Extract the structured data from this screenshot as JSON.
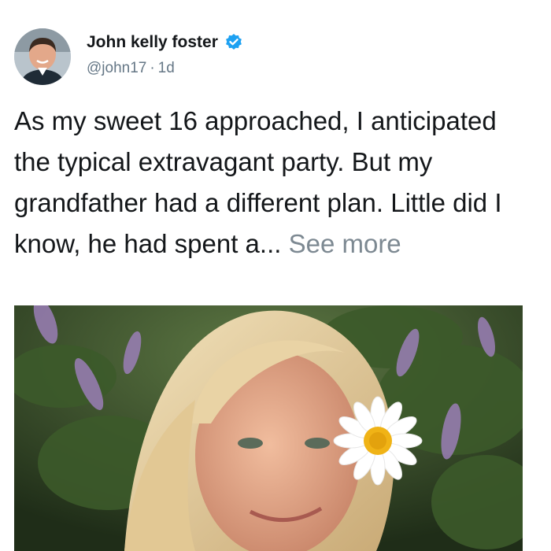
{
  "tweet": {
    "author_name": "John kelly foster",
    "handle": "@john17",
    "separator": "·",
    "time": "1d",
    "body": "As my sweet 16 approached, I anticipated the typical extravagant party. But my grandfather had a different plan. Little did I know, he had spent a...",
    "see_more": "See more",
    "verified_icon": "verified-badge-icon",
    "colors": {
      "text": "#14171a",
      "muted": "#657786",
      "verified": "#1da1f2"
    }
  }
}
